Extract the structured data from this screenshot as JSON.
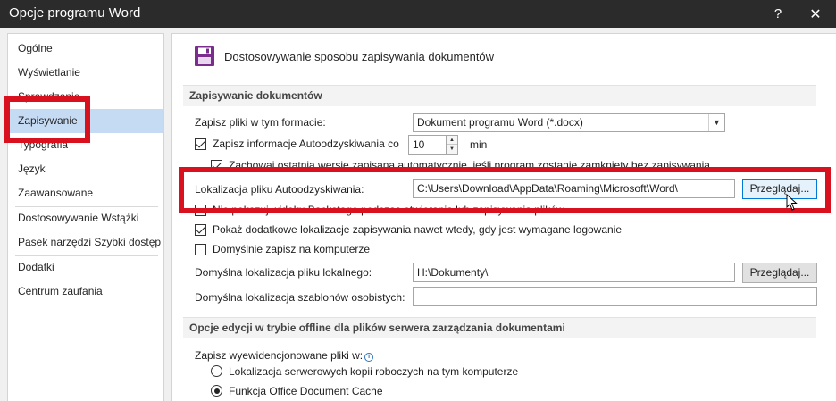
{
  "window": {
    "title": "Opcje programu Word",
    "help_label": "?",
    "close_label": "✕"
  },
  "sidebar": {
    "items": [
      {
        "label": "Ogólne"
      },
      {
        "label": "Wyświetlanie"
      },
      {
        "label": "Sprawdzanie"
      },
      {
        "label": "Zapisywanie",
        "selected": true
      },
      {
        "label": "Typografia"
      },
      {
        "label": "Język"
      },
      {
        "label": "Zaawansowane"
      },
      {
        "label": "Dostosowywanie Wstążki"
      },
      {
        "label": "Pasek narzędzi Szybki dostęp"
      },
      {
        "label": "Dodatki"
      },
      {
        "label": "Centrum zaufania"
      }
    ]
  },
  "content": {
    "heading": "Dostosowywanie sposobu zapisywania dokumentów",
    "section1": {
      "title": "Zapisywanie dokumentów",
      "save_format_label": "Zapisz pliki w tym formacie:",
      "save_format_value": "Dokument programu Word (*.docx)",
      "autorecover_label": "Zapisz informacje Autoodzyskiwania co",
      "autorecover_checked": true,
      "autorecover_value": "10",
      "autorecover_unit": "min",
      "keep_last_label": "Zachowaj ostatnią wersję zapisaną automatycznie, jeśli program zostanie zamknięty bez zapisywania",
      "keep_last_checked": true,
      "autorecover_location_label": "Lokalizacja pliku Autoodzyskiwania:",
      "autorecover_location_value": "C:\\Users\\Download\\AppData\\Roaming\\Microsoft\\Word\\",
      "browse_label": "Przeglądaj...",
      "hidden_row_label": "Nie pokazuj widoku Backstage podczas otwierania lub zapisywania plików",
      "hidden_row_checked": false,
      "show_extra_label": "Pokaż dodatkowe lokalizacje zapisywania nawet wtedy, gdy jest wymagane logowanie",
      "show_extra_checked": true,
      "default_save_computer_label": "Domyślnie zapisz na komputerze",
      "default_save_computer_checked": false,
      "default_local_label": "Domyślna lokalizacja pliku lokalnego:",
      "default_local_value": "H:\\Dokumenty\\",
      "browse_label_2": "Przeglądaj...",
      "templates_label": "Domyślna lokalizacja szablonów osobistych:",
      "templates_value": ""
    },
    "section2": {
      "title": "Opcje edycji w trybie offline dla plików serwera zarządzania dokumentami",
      "checked_out_label": "Zapisz wyewidencjonowane pliki w:",
      "radio1_label": "Lokalizacja serwerowych kopii roboczych na tym komputerze",
      "radio1_checked": false,
      "radio2_label": "Funkcja Office Document Cache",
      "radio2_checked": true
    }
  },
  "colors": {
    "titlebar_bg": "#2b2b2b",
    "selected_bg": "#c5daf3",
    "highlight_red": "#d9111e",
    "save_icon": "#7a2d8c"
  }
}
